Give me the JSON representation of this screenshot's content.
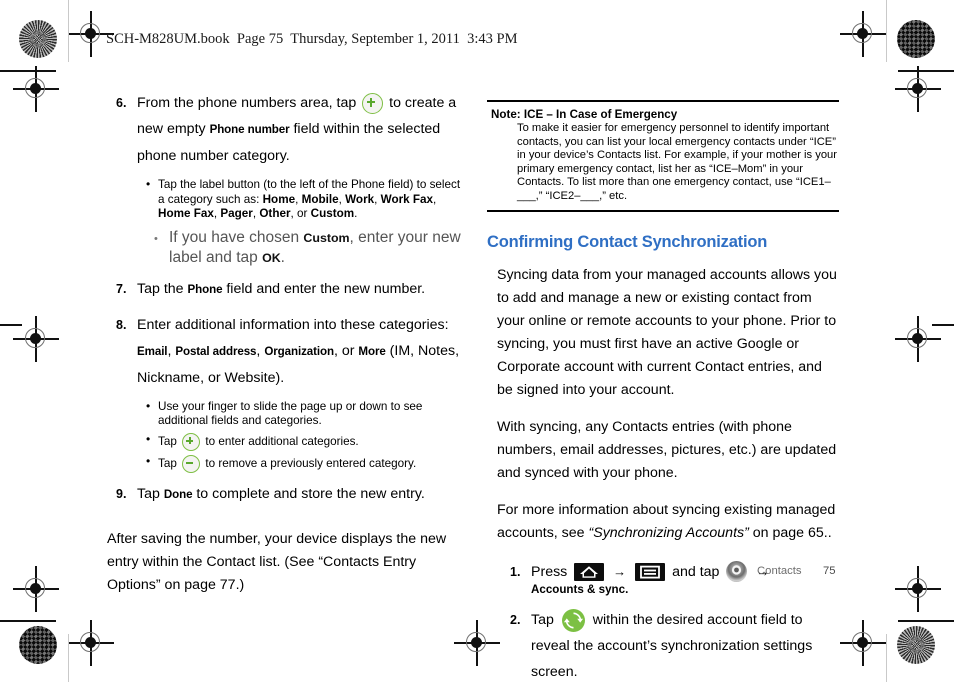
{
  "doc_header": "SCH-M828UM.book  Page 75  Thursday, September 1, 2011  3:43 PM",
  "left_column": {
    "steps": [
      {
        "num": "6.",
        "text_before_icon": "From the phone numbers area, tap",
        "icon": "circle-plus-icon",
        "text_after_icon_1": "to create a new empty",
        "bold_1": "Phone number",
        "text_after_icon_2": "field within the selected phone number category.",
        "bullets": [
          {
            "style": "small",
            "segments": [
              {
                "t": "Tap the label button (to the left of the Phone field) to select a category such as: ",
                "b": false
              },
              {
                "t": "Home",
                "b": true
              },
              {
                "t": ", ",
                "b": false
              },
              {
                "t": "Mobile",
                "b": true
              },
              {
                "t": ", ",
                "b": false
              },
              {
                "t": "Work",
                "b": true
              },
              {
                "t": ", ",
                "b": false
              },
              {
                "t": "Work Fax",
                "b": true
              },
              {
                "t": ", ",
                "b": false
              },
              {
                "t": "Home Fax",
                "b": true
              },
              {
                "t": ", ",
                "b": false
              },
              {
                "t": "Pager",
                "b": true
              },
              {
                "t": ", ",
                "b": false
              },
              {
                "t": "Other",
                "b": true
              },
              {
                "t": ", or ",
                "b": false
              },
              {
                "t": "Custom",
                "b": true
              },
              {
                "t": ".",
                "b": false
              }
            ]
          },
          {
            "style": "big",
            "segments": [
              {
                "t": "If you have chosen ",
                "b": false
              },
              {
                "t": "Custom",
                "b": true
              },
              {
                "t": ", enter your new label and tap ",
                "b": false
              },
              {
                "t": "OK",
                "b": true
              },
              {
                "t": ".",
                "b": false
              }
            ]
          }
        ]
      },
      {
        "num": "7.",
        "segments": [
          {
            "t": "Tap the ",
            "b": false
          },
          {
            "t": "Phone",
            "b": true
          },
          {
            "t": " field and enter the new number.",
            "b": false
          }
        ],
        "bullets": []
      },
      {
        "num": "8.",
        "segments": [
          {
            "t": "Enter additional information into these categories: ",
            "b": false
          },
          {
            "t": "Email",
            "b": true
          },
          {
            "t": ", ",
            "b": false
          },
          {
            "t": "Postal address",
            "b": true
          },
          {
            "t": ", ",
            "b": false
          },
          {
            "t": "Organization",
            "b": true
          },
          {
            "t": ", or ",
            "b": false
          },
          {
            "t": "More",
            "b": true
          },
          {
            "t": " (IM, Notes, Nickname, or Website).",
            "b": false
          }
        ],
        "bullets": [
          {
            "style": "small",
            "segments": [
              {
                "t": "Use your finger to slide the page up or down to see additional fields and categories.",
                "b": false
              }
            ]
          },
          {
            "style": "small-icon",
            "icon": "circle-plus-icon",
            "before": "Tap",
            "after": "to enter additional categories."
          },
          {
            "style": "small-icon",
            "icon": "circle-minus-icon",
            "before": "Tap",
            "after": "to remove a previously entered category."
          }
        ]
      },
      {
        "num": "9.",
        "segments": [
          {
            "t": "Tap ",
            "b": false
          },
          {
            "t": "Done",
            "b": true
          },
          {
            "t": " to complete and store the new entry.",
            "b": false
          }
        ],
        "bullets": []
      }
    ],
    "closing_paragraph": "After saving the number, your device displays the new entry within the Contact list. (See “Contacts Entry Options” on page 77.)"
  },
  "right_column": {
    "note": {
      "title": "Note: ICE – In Case of Emergency",
      "body": "To make it easier for emergency personnel to identify important contacts, you can list your local emergency contacts under “ICE” in your device’s Contacts list. For example, if your mother is your primary emergency contact, list her as “ICE–Mom” in your Contacts. To list more than one emergency contact, use “ICE1–___,” “ICE2–___,” etc."
    },
    "heading": "Confirming Contact Synchronization",
    "heading_color": "#2f6fc4",
    "paragraphs": [
      "Syncing data from your managed accounts allows you to add and manage a new or existing contact from your online or remote accounts to your phone. Prior to syncing, you must first have an active Google or Corporate account with current Contact entries, and be signed into your account.",
      "With syncing, any Contacts entries (with phone numbers, email addresses, pictures, etc.) are updated and synced with your phone."
    ],
    "reference_paragraph": {
      "before": "For more information about syncing existing managed accounts, see ",
      "italic": "“Synchronizing Accounts”",
      "after": " on page 65.."
    },
    "steps": [
      {
        "num": "1.",
        "label_press": "Press",
        "icon_1": "home-button-icon",
        "arrow_1": "→",
        "icon_2": "menu-button-icon",
        "label_mid": "and tap",
        "icon_3": "settings-dial-icon",
        "arrow_2": "→",
        "bold_target": "Accounts & sync."
      },
      {
        "num": "2.",
        "label_tap": "Tap",
        "icon": "sync-refresh-icon",
        "text_after": "within the desired account field to reveal the account’s synchronization settings screen."
      }
    ]
  },
  "footer": {
    "section": "Contacts",
    "page": "75"
  }
}
